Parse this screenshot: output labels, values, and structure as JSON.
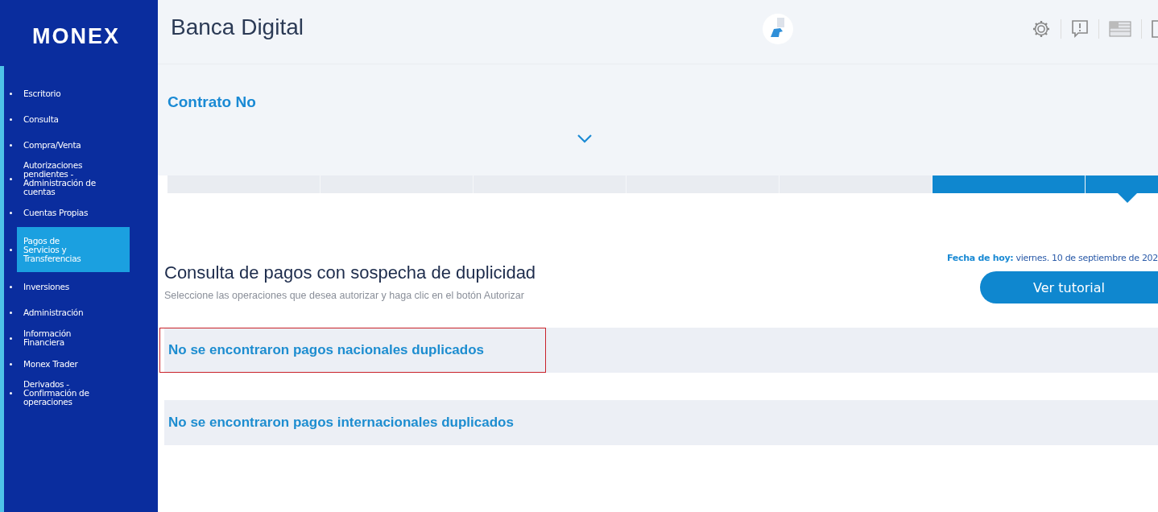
{
  "sidebar": {
    "logo": "MONEX",
    "items": [
      {
        "label": "Escritorio",
        "selected": false
      },
      {
        "label": "Consulta",
        "selected": false
      },
      {
        "label": "Compra/Venta",
        "selected": false
      },
      {
        "label": "Autorizaciones pendientes - Administración de cuentas",
        "selected": false
      },
      {
        "label": "Cuentas Propias",
        "selected": false
      },
      {
        "label": "Pagos de Servicios y Transferencias",
        "selected": true
      },
      {
        "label": "Inversiones",
        "selected": false
      },
      {
        "label": "Administración",
        "selected": false
      },
      {
        "label": "Información Financiera",
        "selected": false
      },
      {
        "label": "Monex Trader",
        "selected": false
      },
      {
        "label": "Derivados - Confirmación de operaciones",
        "selected": false
      }
    ]
  },
  "header": {
    "title": "Banca Digital"
  },
  "contract": {
    "label": "Contrato No",
    "expanded": false
  },
  "tab_strip": [
    {
      "active": false,
      "selected": false
    },
    {
      "active": false,
      "selected": false
    },
    {
      "active": false,
      "selected": false
    },
    {
      "active": false,
      "selected": false
    },
    {
      "active": false,
      "selected": false
    },
    {
      "active": true,
      "selected": false
    },
    {
      "active": true,
      "selected": true
    }
  ],
  "page": {
    "title": "Consulta de pagos con sospecha de duplicidad",
    "subtitle": "Seleccione las operaciones que desea autorizar y haga clic en el botón Autorizar",
    "date_label": "Fecha de hoy:",
    "date_value": "viernes. 10 de septiembre de 202",
    "button": "Ver tutorial"
  },
  "results": [
    {
      "text": "No se encontraron pagos nacionales duplicados",
      "highlighted": true
    },
    {
      "text": "No se encontraron pagos internacionales duplicados",
      "highlighted": false
    }
  ]
}
